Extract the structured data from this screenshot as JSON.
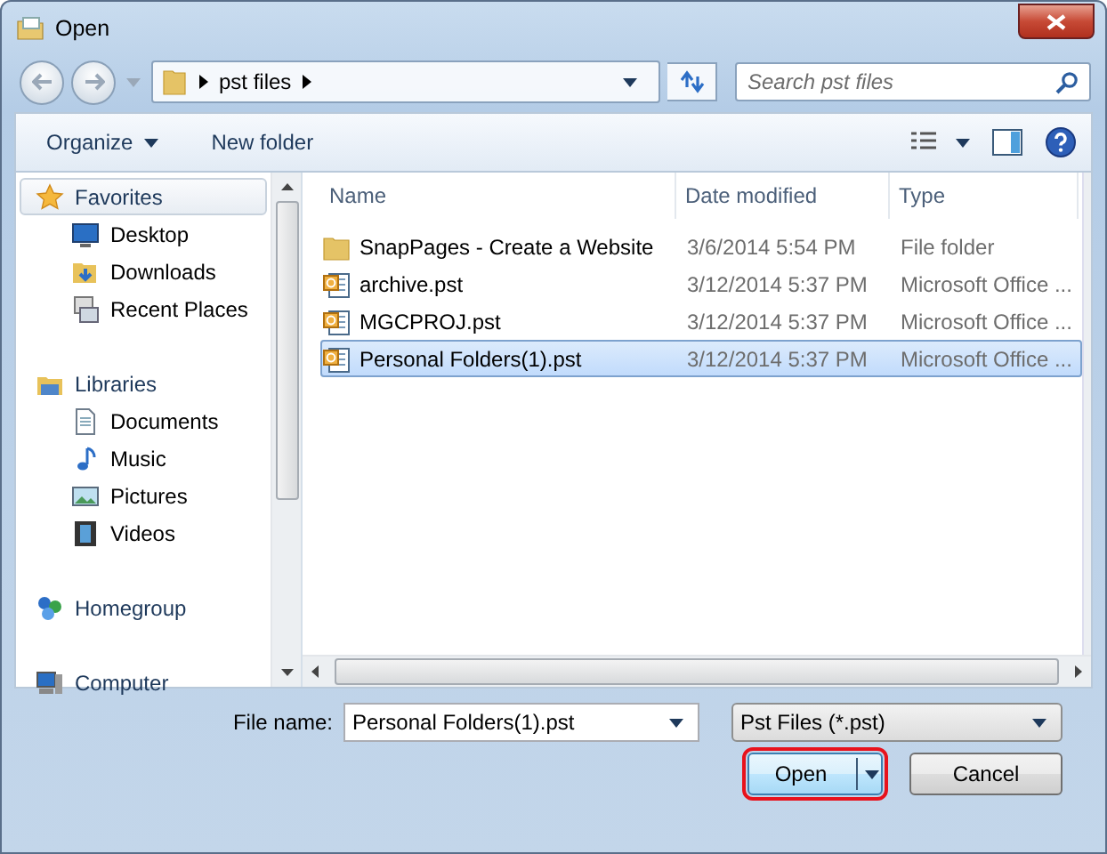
{
  "window": {
    "title": "Open"
  },
  "address_bar": {
    "path": [
      "pst files"
    ]
  },
  "search": {
    "placeholder": "Search pst files"
  },
  "toolbar": {
    "items": [
      "Organize",
      "New folder"
    ]
  },
  "sidebar": {
    "items": [
      {
        "label": "Favorites",
        "selected": true,
        "children": [
          {
            "label": "Desktop",
            "selected": false
          },
          {
            "label": "Downloads",
            "selected": false
          },
          {
            "label": "Recent Places",
            "selected": false
          }
        ]
      },
      {
        "label": "Libraries",
        "selected": false,
        "children": [
          {
            "label": "Documents",
            "selected": false
          },
          {
            "label": "Music",
            "selected": false
          },
          {
            "label": "Pictures",
            "selected": false
          },
          {
            "label": "Videos",
            "selected": false
          }
        ]
      },
      {
        "label": "Homegroup",
        "selected": false
      },
      {
        "label": "Computer",
        "selected": false
      }
    ]
  },
  "table": {
    "columns": [
      "Name",
      "Date modified",
      "Type"
    ],
    "rows": [
      {
        "kind": "folder",
        "name": "SnapPages - Create a Website",
        "date": "3/6/2014 5:54 PM",
        "type": "File folder",
        "selected": false
      },
      {
        "kind": "pst",
        "name": "archive.pst",
        "date": "3/12/2014 5:37 PM",
        "type": "Microsoft Office ...",
        "selected": false
      },
      {
        "kind": "pst",
        "name": "MGCPROJ.pst",
        "date": "3/12/2014 5:37 PM",
        "type": "Microsoft Office ...",
        "selected": false
      },
      {
        "kind": "pst",
        "name": "Personal Folders(1).pst",
        "date": "3/12/2014 5:37 PM",
        "type": "Microsoft Office ...",
        "selected": true
      }
    ]
  },
  "footer": {
    "file_name_label": "File name:",
    "file_name": "Personal Folders(1).pst",
    "file_type": "Pst Files (*.pst)",
    "buttons": [
      {
        "label": "Open",
        "kind": "split",
        "highlighted": true
      },
      {
        "label": "Cancel",
        "kind": "plain",
        "highlighted": false
      }
    ]
  }
}
